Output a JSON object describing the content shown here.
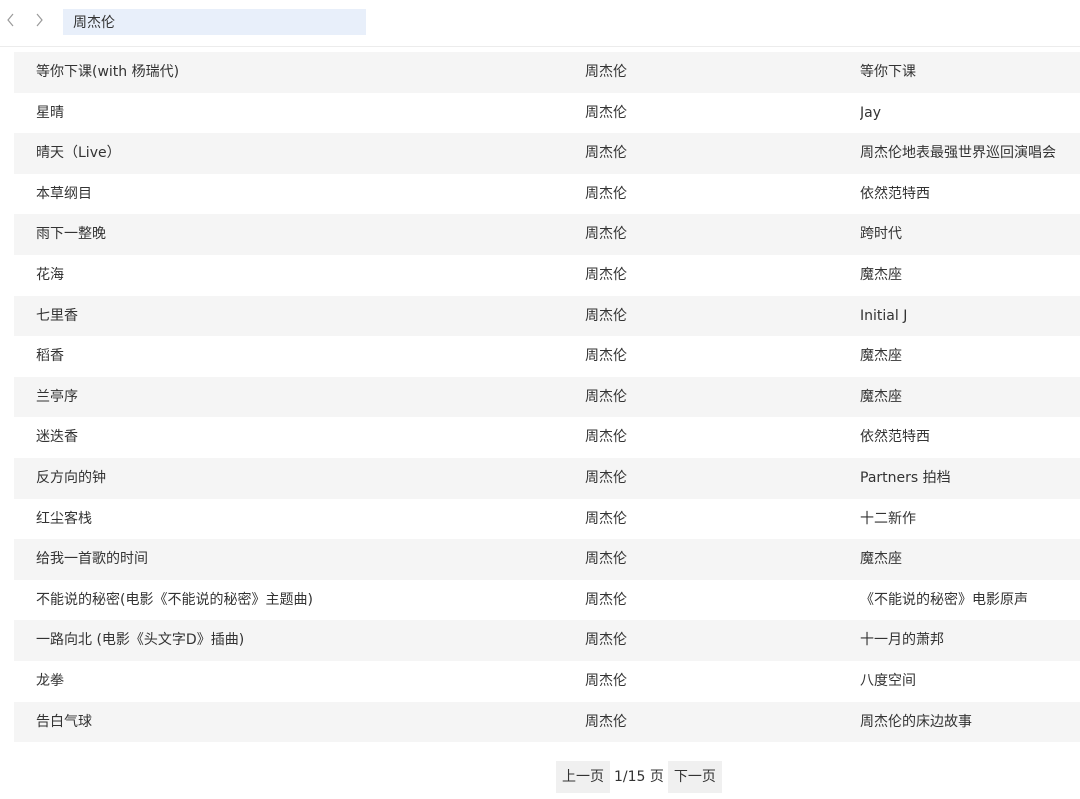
{
  "search": {
    "value": "周杰伦"
  },
  "songs": [
    {
      "title": "等你下课(with 杨瑞代)",
      "artist": "周杰伦",
      "album": "等你下课"
    },
    {
      "title": "星晴",
      "artist": "周杰伦",
      "album": "Jay"
    },
    {
      "title": "晴天（Live）",
      "artist": "周杰伦",
      "album": "周杰伦地表最强世界巡回演唱会"
    },
    {
      "title": "本草纲目",
      "artist": "周杰伦",
      "album": "依然范特西"
    },
    {
      "title": "雨下一整晚",
      "artist": "周杰伦",
      "album": "跨时代"
    },
    {
      "title": "花海",
      "artist": "周杰伦",
      "album": "魔杰座"
    },
    {
      "title": "七里香",
      "artist": "周杰伦",
      "album": "Initial J"
    },
    {
      "title": "稻香",
      "artist": "周杰伦",
      "album": "魔杰座"
    },
    {
      "title": "兰亭序",
      "artist": "周杰伦",
      "album": "魔杰座"
    },
    {
      "title": "迷迭香",
      "artist": "周杰伦",
      "album": "依然范特西"
    },
    {
      "title": "反方向的钟",
      "artist": "周杰伦",
      "album": "Partners 拍档"
    },
    {
      "title": "红尘客栈",
      "artist": "周杰伦",
      "album": "十二新作"
    },
    {
      "title": "给我一首歌的时间",
      "artist": "周杰伦",
      "album": "魔杰座"
    },
    {
      "title": "不能说的秘密(电影《不能说的秘密》主题曲)",
      "artist": "周杰伦",
      "album": "《不能说的秘密》电影原声"
    },
    {
      "title": "一路向北 (电影《头文字D》插曲)",
      "artist": "周杰伦",
      "album": "十一月的萧邦"
    },
    {
      "title": "龙拳",
      "artist": "周杰伦",
      "album": "八度空间"
    },
    {
      "title": "告白气球",
      "artist": "周杰伦",
      "album": "周杰伦的床边故事"
    }
  ],
  "pager": {
    "prev_label": "上一页",
    "info": "1/15 页",
    "next_label": "下一页"
  },
  "icons": {
    "back": "chevron-left-icon",
    "forward": "chevron-right-icon"
  },
  "colors": {
    "search_bg": "#e8effa",
    "row_alt_bg": "#f5f5f5",
    "pager_bg": "#f0f0f0"
  }
}
